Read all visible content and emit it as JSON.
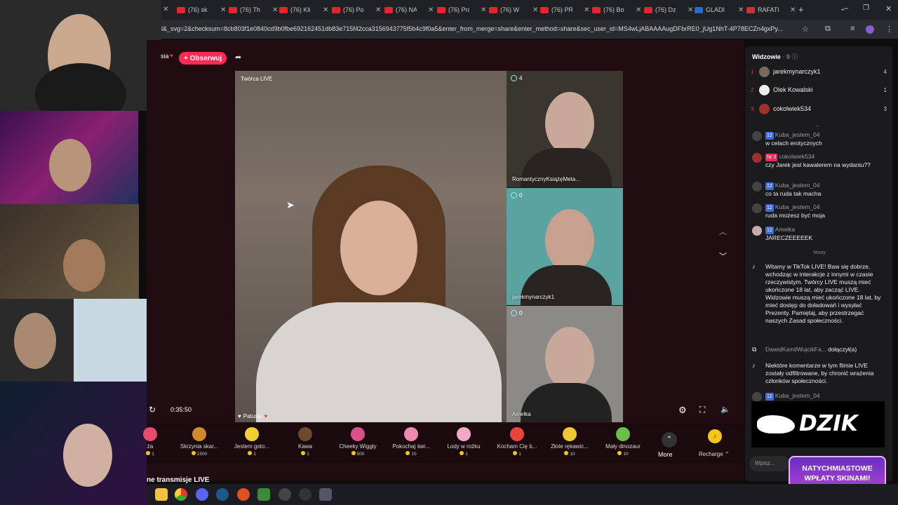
{
  "browser": {
    "tabs": [
      {
        "title": "(76) sk"
      },
      {
        "title": "(76) Th"
      },
      {
        "title": "(76) Kli"
      },
      {
        "title": "(76) Po"
      },
      {
        "title": "(76) NA"
      },
      {
        "title": "(76) Pro"
      },
      {
        "title": "(76) W"
      },
      {
        "title": "(76) PR"
      },
      {
        "title": "(76) Bo"
      },
      {
        "title": "(76) Dz"
      },
      {
        "title": "GLADI"
      },
      {
        "title": "RAFATI"
      }
    ],
    "url": "l&_svg=2&checksum=8cb803f1e0840cd9b0fbe692162451db83e715f42cca3156943775f5b4c9f0a5&enter_from_merge=share&enter_method=share&sec_user_id=MS4wLjABAAAAugDFbrRE0_jUg1NhT-4P78ECZn4gxPy..."
  },
  "stream": {
    "name_fragment": "sia",
    "follow_label": "+ Obserwuj",
    "creator_label": "Twórca LIVE",
    "host_name": "Patusia",
    "duration": "0:35:50",
    "bottom_heading": "ne transmisje LIVE",
    "guests": [
      {
        "name": "RomantycznyKsiążęMeta...",
        "viewers": "4",
        "bg": "#3b3530"
      },
      {
        "name": "jarekmynarczyk1",
        "viewers": "0",
        "bg": "#5aa3a0"
      },
      {
        "name": "Amelka",
        "viewers": "0",
        "bg": "#8b8a86"
      }
    ]
  },
  "gifts": [
    {
      "name": "ża",
      "price": "1",
      "color": "#e84a6a"
    },
    {
      "name": "Skrzynia skar...",
      "price": "1500",
      "color": "#d08a2a"
    },
    {
      "name": "Jestem goto...",
      "price": "1",
      "color": "#f0d032"
    },
    {
      "name": "Kawa",
      "price": "1",
      "color": "#6b4a2e"
    },
    {
      "name": "Cheeky Wiggly",
      "price": "500",
      "color": "#d9508a"
    },
    {
      "name": "Pokochaj świ...",
      "price": "10",
      "color": "#f08ab0"
    },
    {
      "name": "Lody w rożku",
      "price": "1",
      "color": "#f4a8c8"
    },
    {
      "name": "Kocham Cię b...",
      "price": "1",
      "color": "#e8463a"
    },
    {
      "name": "Złote rękawic...",
      "price": "10",
      "color": "#f0c832"
    },
    {
      "name": "Mały dinozaur",
      "price": "10",
      "color": "#6ac04a"
    }
  ],
  "more_label": "More",
  "recharge_label": "Recharge",
  "sidebar": {
    "viewers_title": "Widzowie",
    "viewers_count": "· 9",
    "top_viewers": [
      {
        "rank": "1",
        "name": "jarekmynarczyk1",
        "score": "4",
        "color": "#7a6a5a"
      },
      {
        "rank": "2",
        "name": "Olek Kowalski",
        "score": "1",
        "color": "#eeeeee"
      },
      {
        "rank": "3",
        "name": "cokolwiek534",
        "score": "3",
        "color": "#a03030"
      }
    ],
    "messages": [
      {
        "name": "Kuba_jestem_04",
        "level": "12",
        "text": "w celach erotycznych",
        "color": "#444"
      },
      {
        "name": "cokolwiek534",
        "level": "Nr 3",
        "text": "czy Jarek jest kawalerem na wydaniu??",
        "color": "#a03030"
      },
      {
        "name": "Kuba_jestem_04",
        "level": "12",
        "text": "co ta ruda tak macha",
        "color": "#444"
      },
      {
        "name": "Kuba_jestem_04",
        "level": "12",
        "text": "ruda możesz być moja",
        "color": "#444"
      },
      {
        "name": "Amelka",
        "level": "12",
        "text": "JARECZEEEEEK",
        "color": "#caa"
      }
    ],
    "new_label": "Nowy",
    "system_welcome": "Witamy w TikTok LIVE! Baw się dobrze, wchodząc w interakcje z innymi w czasie rzeczywistym. Twórcy LIVE muszą mieć ukończone 18 lat, aby zacząć LIVE. Widzowie muszą mieć ukończone 18 lat, by mieć dostęp do doładowań i wysyłać Prezenty. Pamiętaj, aby przestrzegać naszych Zasad społeczności.",
    "join_user": "DawidKamilWujcikFa...",
    "join_text": "dołączył(a)",
    "system_filter": "Niektóre komentarze w tym filmie LIVE zostały odfiltrowane, by chronić wrażenia członków społeczności.",
    "last_name": "Kuba_jestem_04",
    "chat_placeholder": "Wpisz..."
  },
  "overlay": {
    "brand": "DZIK",
    "promo_line1": "NATYCHMIASTOWE",
    "promo_line2": "WPŁATY SKINAMI!"
  }
}
